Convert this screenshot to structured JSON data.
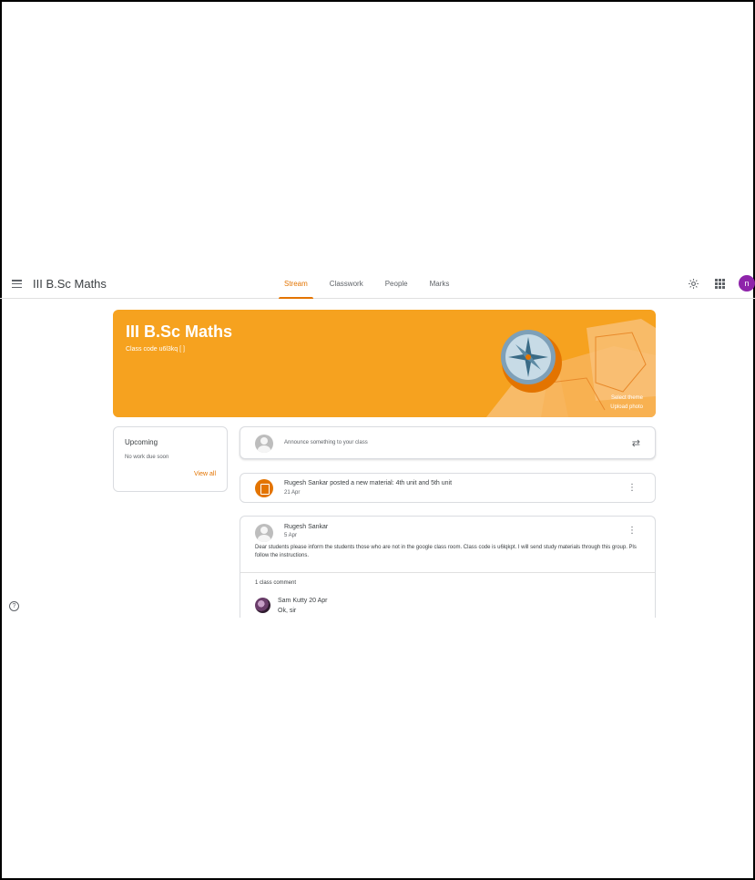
{
  "header": {
    "class_title": "III B.Sc Maths",
    "avatar_letter": "n",
    "tabs": [
      {
        "label": "Stream",
        "active": true
      },
      {
        "label": "Classwork",
        "active": false
      },
      {
        "label": "People",
        "active": false
      },
      {
        "label": "Marks",
        "active": false
      }
    ]
  },
  "banner": {
    "title": "III B.Sc Maths",
    "class_code": "Class code  u6l3kq [ ]",
    "select_theme": "Select theme",
    "upload_photo": "Upload photo",
    "color": "#f6a21f"
  },
  "upcoming": {
    "title": "Upcoming",
    "empty_text": "No work due soon",
    "view_all": "View all"
  },
  "announce": {
    "placeholder": "Announce something to your class"
  },
  "material": {
    "text": "Rugesh Sankar posted a new material: 4th unit and 5th unit",
    "date": "21 Apr"
  },
  "post": {
    "author": "Rugesh Sankar",
    "date": "5 Apr",
    "body": "Dear students please inform the students those who are not in the google class room. Class code is u6lqkpt. I will send study materials through this group. Pls follow the instructions.",
    "comments_count": "1 class comment",
    "comment": {
      "author": "Sam Kutty",
      "date": "20 Apr",
      "text": "Ok, sir"
    }
  },
  "accent_color": "#e37400"
}
